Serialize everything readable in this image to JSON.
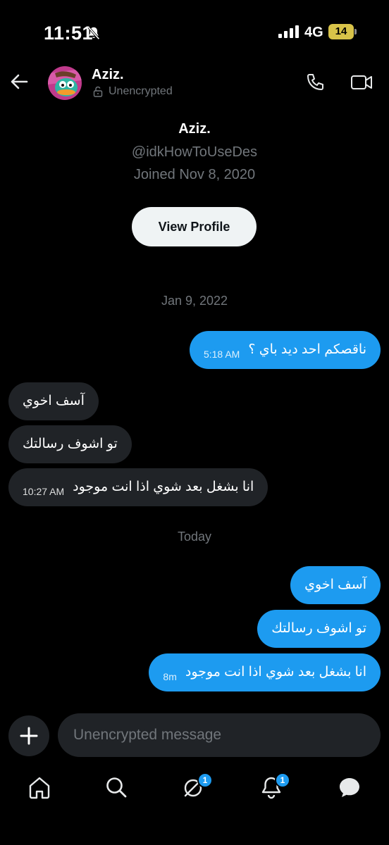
{
  "status_bar": {
    "time": "11:51",
    "network": "4G",
    "battery": "14",
    "battery_color": "#d8c349"
  },
  "header": {
    "name": "Aziz.",
    "encryption": "Unencrypted"
  },
  "profile": {
    "name": "Aziz.",
    "handle": "@idkHowToUseDes",
    "joined": "Joined Nov 8, 2020",
    "view_profile_label": "View Profile"
  },
  "dates": {
    "first": "Jan 9, 2022",
    "second": "Today"
  },
  "messages": [
    {
      "text": "ناقصكم احد ديد باي ؟",
      "time": "5:18 AM",
      "type": "sent"
    },
    {
      "text": "آسف اخوي",
      "time": "",
      "type": "received"
    },
    {
      "text": "تو اشوف رسالتك",
      "time": "",
      "type": "received"
    },
    {
      "text": "انا بشغل بعد شوي اذا انت موجود",
      "time": "10:27 AM",
      "type": "received"
    },
    {
      "text": "آسف اخوي",
      "time": "",
      "type": "sent"
    },
    {
      "text": "تو اشوف رسالتك",
      "time": "",
      "type": "sent"
    },
    {
      "text": "انا بشغل بعد شوي اذا انت موجود",
      "time": "8m",
      "type": "sent"
    }
  ],
  "composer": {
    "placeholder": "Unencrypted message"
  },
  "nav": {
    "items": [
      {
        "icon": "home-icon"
      },
      {
        "icon": "search-icon"
      },
      {
        "icon": "grok-icon",
        "badge": "1"
      },
      {
        "icon": "notifications-icon",
        "badge": "1"
      },
      {
        "icon": "messages-icon"
      }
    ]
  },
  "colors": {
    "accent": "#1d9bf0",
    "received_bubble": "#202327",
    "muted_text": "#71767b"
  }
}
